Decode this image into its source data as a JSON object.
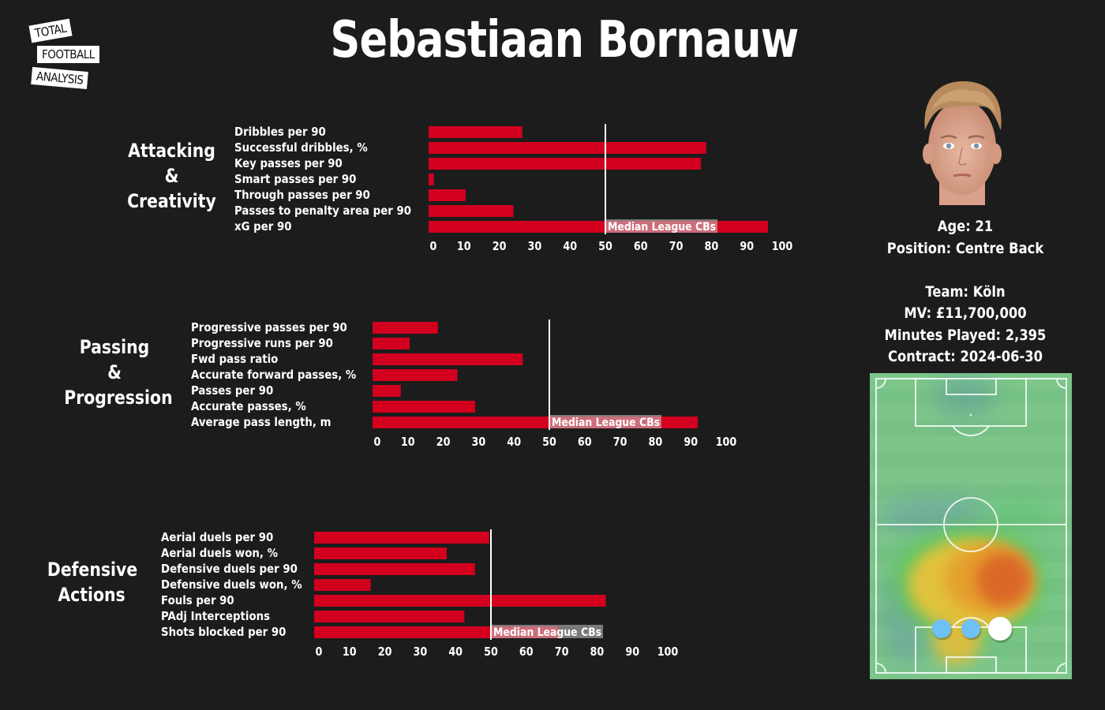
{
  "logo": {
    "line1": "TOTAL",
    "line2": "FOOTBALL",
    "line3": "ANALYSIS"
  },
  "title": "Sebastiaan Bornauw",
  "colors": {
    "background": "#1c1c1c",
    "bar": "#d2001e",
    "median_line": "#ffffff",
    "text": "#ffffff"
  },
  "player": {
    "age": "Age: 21",
    "position": "Position: Centre Back",
    "team": "Team: Köln",
    "mv": "MV: £11,700,000",
    "minutes": "Minutes Played: 2,395",
    "contract": "Contract: 2024-06-30"
  },
  "sections": [
    {
      "title_lines": [
        "Attacking",
        "&",
        "Creativity"
      ]
    },
    {
      "title_lines": [
        "Passing",
        "&",
        "Progression"
      ]
    },
    {
      "title_lines": [
        "Defensive",
        "Actions"
      ]
    }
  ],
  "chart_data": [
    {
      "type": "bar",
      "orientation": "horizontal",
      "title": "Attacking & Creativity",
      "categories": [
        "Dribbles per 90",
        "Successful dribbles, %",
        "Key passes per 90",
        "Smart passes per 90",
        "Through passes per 90",
        "Passes to penalty area per 90",
        "xG per 90"
      ],
      "values": [
        26.5,
        78.5,
        77,
        1.5,
        10.5,
        24,
        96
      ],
      "xlim": [
        0,
        100
      ],
      "xticks": [
        0,
        10,
        20,
        30,
        40,
        50,
        60,
        70,
        80,
        90,
        100
      ],
      "reference_line": {
        "value": 50,
        "label": "Median League CBs"
      },
      "units": "percentile"
    },
    {
      "type": "bar",
      "orientation": "horizontal",
      "title": "Passing & Progression",
      "categories": [
        "Progressive passes per 90",
        "Progressive runs per 90",
        "Fwd pass ratio",
        "Accurate forward passes, %",
        "Passes per 90",
        "Accurate passes, %",
        "Average pass length, m"
      ],
      "values": [
        18.5,
        10.5,
        42.5,
        24,
        8,
        29,
        92
      ],
      "xlim": [
        0,
        100
      ],
      "xticks": [
        0,
        10,
        20,
        30,
        40,
        50,
        60,
        70,
        80,
        90,
        100
      ],
      "reference_line": {
        "value": 50,
        "label": "Median League CBs"
      },
      "units": "percentile"
    },
    {
      "type": "bar",
      "orientation": "horizontal",
      "title": "Defensive Actions",
      "categories": [
        "Aerial duels per 90",
        "Aerial duels won, %",
        "Defensive duels per 90",
        "Defensive duels won, %",
        "Fouls per 90",
        "PAdj Interceptions",
        "Shots blocked per 90"
      ],
      "values": [
        49.5,
        37.5,
        45.5,
        16,
        82.5,
        42.5,
        69
      ],
      "xlim": [
        0,
        100
      ],
      "xticks": [
        0,
        10,
        20,
        30,
        40,
        50,
        60,
        70,
        80,
        90,
        100
      ],
      "reference_line": {
        "value": 50,
        "label": "Median League CBs"
      },
      "units": "percentile"
    }
  ],
  "heatmap": {
    "description": "Player heatmap on vertical pitch, highest intensity right-of-centre in own half",
    "markers": [
      {
        "color": "#6ec1f5",
        "kind": "position"
      },
      {
        "color": "#6ec1f5",
        "kind": "position"
      },
      {
        "color": "#ffffff",
        "kind": "main-position"
      }
    ]
  }
}
